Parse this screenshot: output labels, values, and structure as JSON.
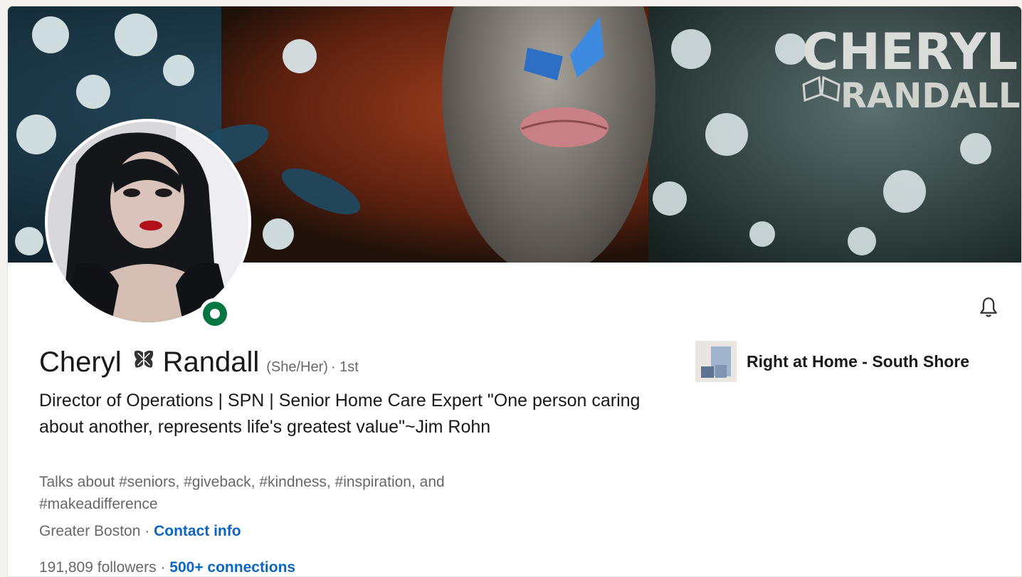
{
  "profile": {
    "first_name": "Cheryl",
    "last_name": "Randall",
    "pronouns": "(She/Her)",
    "degree": "· 1st",
    "headline": "Director of Operations | SPN | Senior Home Care Expert \"One person caring about another, represents life's greatest value\"~Jim Rohn",
    "talks_about": "Talks about #seniors, #giveback, #kindness, #inspiration, and #makeadifference",
    "location": "Greater Boston",
    "location_separator": " · ",
    "contact_info": "Contact info",
    "followers": "191,809 followers",
    "stats_separator": " · ",
    "connections": "500+ connections",
    "online_status_color": "#057642"
  },
  "company": {
    "name": "Right at Home - South Shore"
  },
  "banner": {
    "title_line1": "CHERYL",
    "title_line2": "RANDALL"
  },
  "icons": {
    "bell": "bell-icon",
    "butterfly": "butterfly-icon"
  },
  "colors": {
    "link": "#0a66c2",
    "online": "#057642"
  }
}
